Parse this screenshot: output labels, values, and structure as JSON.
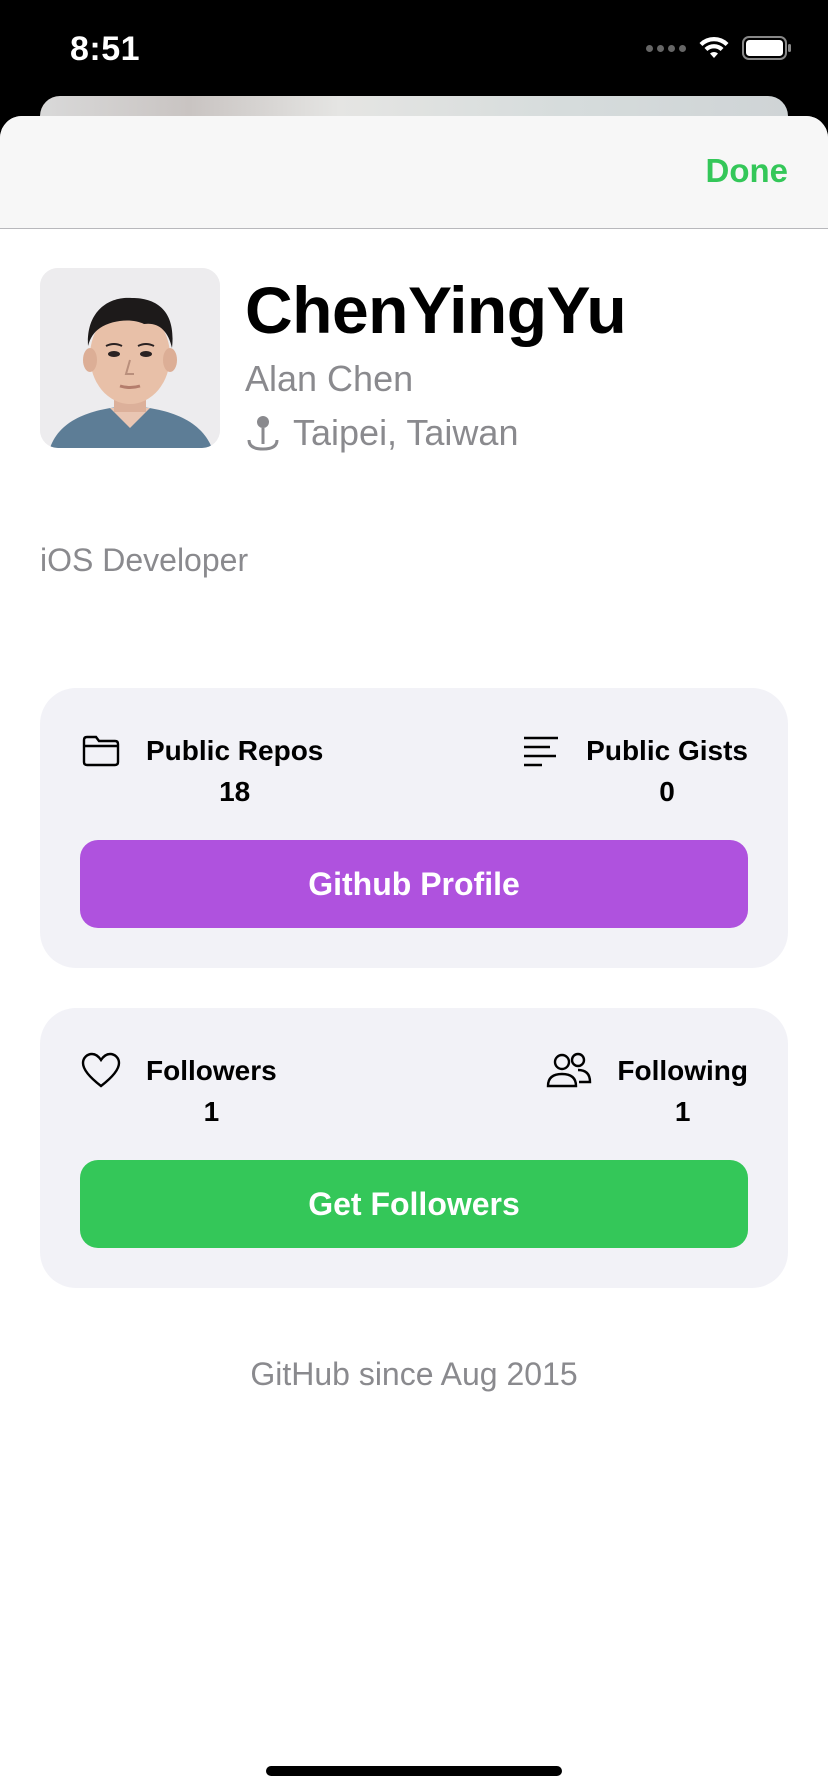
{
  "status_bar": {
    "time": "8:51"
  },
  "nav": {
    "done_label": "Done"
  },
  "profile": {
    "username": "ChenYingYu",
    "name": "Alan Chen",
    "location": "Taipei, Taiwan",
    "bio": "iOS Developer"
  },
  "repo_card": {
    "repos_label": "Public Repos",
    "repos_count": "18",
    "gists_label": "Public Gists",
    "gists_count": "0",
    "button_label": "Github Profile"
  },
  "follow_card": {
    "followers_label": "Followers",
    "followers_count": "1",
    "following_label": "Following",
    "following_count": "1",
    "button_label": "Get Followers"
  },
  "footer": {
    "since_text": "GitHub since Aug 2015"
  },
  "colors": {
    "accent_green": "#34c759",
    "purple": "#af52de",
    "card_bg": "#f2f2f7",
    "secondary_text": "#8a8a8e"
  },
  "icons": [
    "wifi-icon",
    "battery-icon",
    "pin-icon",
    "folder-icon",
    "text-align-left-icon",
    "heart-icon",
    "person-2-icon"
  ]
}
